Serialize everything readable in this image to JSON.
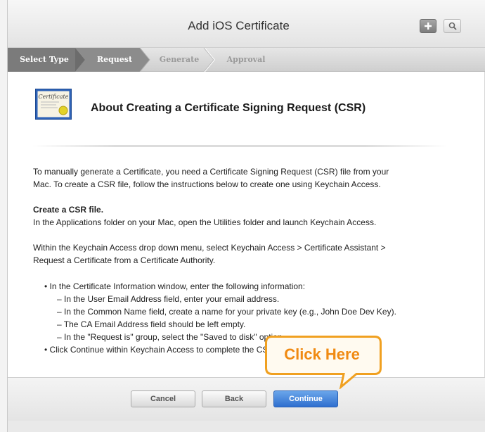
{
  "window": {
    "title": "Add iOS Certificate"
  },
  "toolbar": {
    "add_icon": "plus-icon",
    "search_icon": "search-icon"
  },
  "steps": [
    {
      "label": "Select Type",
      "state": "done"
    },
    {
      "label": "Request",
      "state": "current"
    },
    {
      "label": "Generate",
      "state": "future"
    },
    {
      "label": "Approval",
      "state": "future"
    }
  ],
  "certificate_icon_text": "Certificate",
  "heading": "About Creating a Certificate Signing Request (CSR)",
  "intro": [
    "To manually generate a Certificate, you need a Certificate Signing Request (CSR) file from your",
    "Mac. To create a CSR file, follow the instructions below to create one using Keychain Access."
  ],
  "create_title": "Create a CSR file.",
  "create_text": "In the Applications folder on your Mac, open the Utilities folder and launch Keychain Access.",
  "keychain_text": [
    "Within the Keychain Access drop down menu, select Keychain Access > Certificate Assistant >",
    "Request a Certificate from a Certificate Authority."
  ],
  "bullets": {
    "b1": "In the Certificate Information window, enter the following information:",
    "s1": "In the User Email Address field, enter your email address.",
    "s2": "In the Common Name field, create a name for your private key (e.g., John Doe Dev Key).",
    "s3": "The CA Email Address field should be left empty.",
    "s4": "In the \"Request is\" group, select the \"Saved to disk\" option.",
    "b2": "Click Continue within Keychain Access to complete the CSR generating process."
  },
  "buttons": {
    "cancel": "Cancel",
    "back": "Back",
    "continue": "Continue"
  },
  "callout": {
    "text": "Click Here",
    "color": "#f08a12"
  },
  "colors": {
    "accent_blue": "#3b7ad8",
    "step_done": "#7b7b7b",
    "step_current": "#8c8c8c"
  }
}
